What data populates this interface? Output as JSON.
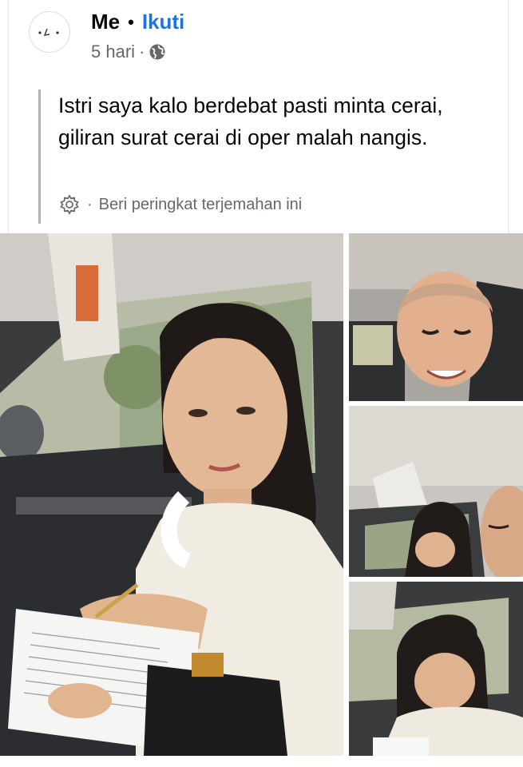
{
  "post": {
    "author": "Me",
    "separator": "•",
    "follow_label": "Ikuti",
    "time": "5 hari",
    "meta_separator": "·",
    "privacy_icon": "globe-icon",
    "text": "Istri saya kalo berdebat pasti minta cerai, giliran surat cerai di oper malah nangis.",
    "translation": {
      "icon": "gear-icon",
      "separator": "·",
      "label": "Beri peringkat terjemahan ini"
    }
  },
  "photos": [
    {
      "id": "photo-1",
      "subject": "woman-signing-in-car"
    },
    {
      "id": "photo-2",
      "subject": "man-selfie-in-car"
    },
    {
      "id": "photo-3",
      "subject": "woman-in-passenger-seat"
    },
    {
      "id": "photo-4",
      "subject": "woman-writing-closeup"
    }
  ],
  "colors": {
    "link": "#1b74e4",
    "secondary_text": "#65676b",
    "quote_bar": "#b0b3b8"
  }
}
